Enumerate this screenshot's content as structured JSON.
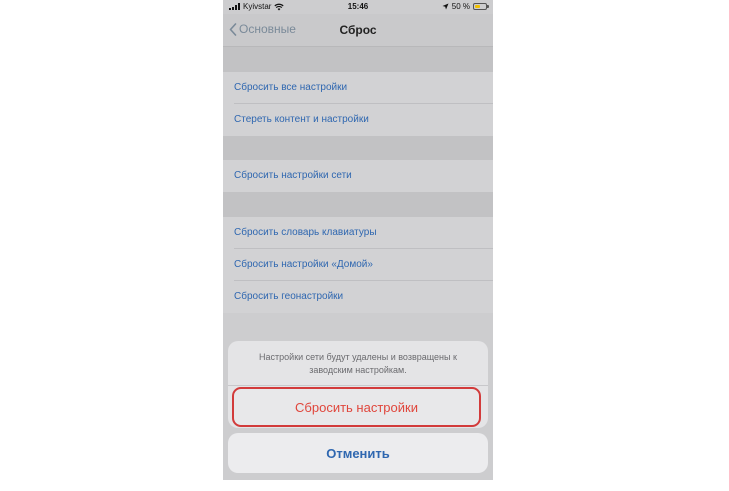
{
  "status_bar": {
    "carrier": "Kyivstar",
    "time": "15:46",
    "battery": "50 %",
    "battery_level": 0.5
  },
  "nav": {
    "back_label": "Основные",
    "title": "Сброс"
  },
  "groups": [
    {
      "items": [
        "Сбросить все настройки",
        "Стереть контент и настройки"
      ]
    },
    {
      "items": [
        "Сбросить настройки сети"
      ]
    },
    {
      "items": [
        "Сбросить словарь клавиатуры",
        "Сбросить настройки «Домой»",
        "Сбросить геонастройки"
      ]
    }
  ],
  "action_sheet": {
    "message": "Настройки сети будут удалены и возвращены к заводским настройкам.",
    "reset_label": "Сбросить настройки",
    "cancel_label": "Отменить"
  },
  "colors": {
    "link": "#2f67b0",
    "destructive": "#e0463c",
    "highlight_border": "#d23b3b",
    "battery": "#f0c000"
  }
}
